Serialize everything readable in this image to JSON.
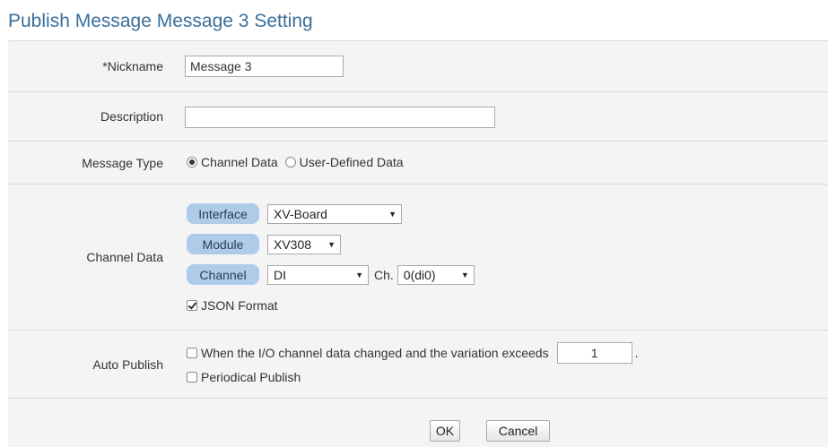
{
  "page_title": "Publish Message Message 3 Setting",
  "nickname": {
    "label": "*Nickname",
    "value": "Message 3",
    "placeholder": ""
  },
  "description": {
    "label": "Description",
    "value": "",
    "placeholder": ""
  },
  "message_type": {
    "label": "Message Type",
    "options": [
      "Channel Data",
      "User-Defined Data"
    ],
    "selected": "Channel Data"
  },
  "channel_data": {
    "label": "Channel Data",
    "interface_label": "Interface",
    "interface_value": "XV-Board",
    "module_label": "Module",
    "module_value": "XV308",
    "channel_label": "Channel",
    "channel_value": "DI",
    "ch_label": "Ch.",
    "ch_value": "0(di0)",
    "json_format_label": "JSON Format",
    "json_format_checked": true
  },
  "auto_publish": {
    "label": "Auto Publish",
    "change_label": "When the I/O channel data changed and the variation exceeds",
    "change_checked": false,
    "variation_value": "1",
    "period_suffix": ".",
    "periodical_label": "Periodical Publish",
    "periodical_checked": false
  },
  "buttons": {
    "ok": "OK",
    "cancel": "Cancel"
  }
}
